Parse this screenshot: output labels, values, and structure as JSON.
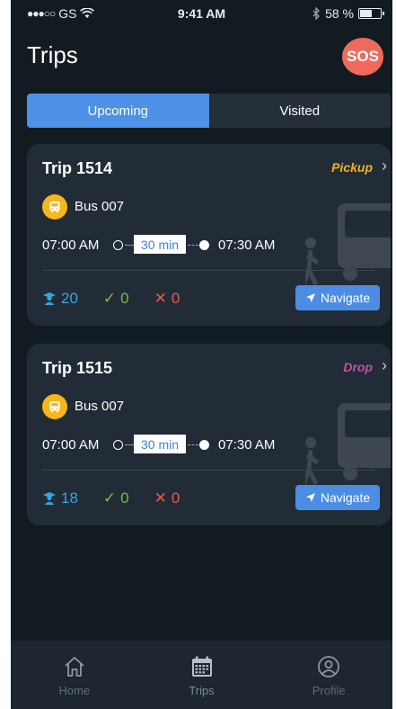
{
  "status_bar": {
    "signal": "●●●○○",
    "carrier": "GS",
    "time": "9:41 AM",
    "battery_pct": "58 %",
    "battery_level": 0.58
  },
  "header": {
    "title": "Trips",
    "sos_label": "SOS"
  },
  "tabs": [
    {
      "label": "Upcoming",
      "active": true
    },
    {
      "label": "Visited",
      "active": false
    }
  ],
  "trips": [
    {
      "title": "Trip 1514",
      "type": "Pickup",
      "type_color": "#f4b21a",
      "bus": "Bus 007",
      "start_time": "07:00 AM",
      "duration": "30 min",
      "end_time": "07:30 AM",
      "students": "20",
      "present": "0",
      "absent": "0",
      "navigate_label": "Navigate"
    },
    {
      "title": "Trip 1515",
      "type": "Drop",
      "type_color": "#c24fa8",
      "bus": "Bus 007",
      "start_time": "07:00 AM",
      "duration": "30 min",
      "end_time": "07:30 AM",
      "students": "18",
      "present": "0",
      "absent": "0",
      "navigate_label": "Navigate"
    }
  ],
  "bottom_nav": [
    {
      "label": "Home",
      "icon": "home-icon"
    },
    {
      "label": "Trips",
      "icon": "calendar-icon"
    },
    {
      "label": "Profile",
      "icon": "profile-icon"
    }
  ],
  "colors": {
    "accent": "#4e91e8",
    "background": "#131b22",
    "card": "#222c36",
    "sos": "#ef6a5b",
    "bus_badge": "#f6b71a"
  }
}
